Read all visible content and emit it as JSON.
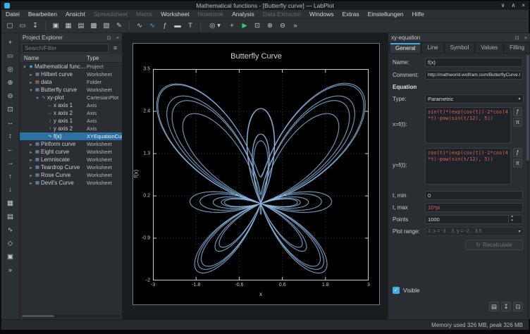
{
  "window": {
    "title": "Mathematical functions - [Butterfly curve] — LabPlot",
    "controls": [
      "∨",
      "∧",
      "×"
    ]
  },
  "icons": {
    "float": "⊡",
    "close": "×",
    "filter": "≡",
    "combo_arrow": "▾",
    "spin_up": "▴",
    "spin_down": "▾",
    "check": "✓"
  },
  "menu": {
    "items": [
      {
        "label": "Datei",
        "enabled": true
      },
      {
        "label": "Bearbeiten",
        "enabled": true
      },
      {
        "label": "Ansicht",
        "enabled": true
      },
      {
        "label": "Spreadsheet",
        "enabled": false
      },
      {
        "label": "Matrix",
        "enabled": false
      },
      {
        "label": "Worksheet",
        "enabled": true
      },
      {
        "label": "Notebook",
        "enabled": false
      },
      {
        "label": "Analysis",
        "enabled": true
      },
      {
        "label": "Data Extractor",
        "enabled": false
      },
      {
        "label": "Windows",
        "enabled": true
      },
      {
        "label": "Extras",
        "enabled": true
      },
      {
        "label": "Einstellungen",
        "enabled": true
      },
      {
        "label": "Hilfe",
        "enabled": true
      }
    ]
  },
  "toolbar": {
    "buttons": [
      {
        "name": "new-project",
        "glyph": "▢"
      },
      {
        "name": "open-project",
        "glyph": "▭"
      },
      {
        "name": "save-project",
        "glyph": "↧"
      },
      {
        "separator": true
      },
      {
        "name": "new-folder",
        "glyph": "▣"
      },
      {
        "name": "new-workbook",
        "glyph": "▦"
      },
      {
        "name": "new-spreadsheet",
        "glyph": "▤"
      },
      {
        "name": "new-matrix",
        "glyph": "▩"
      },
      {
        "name": "new-worksheet",
        "glyph": "▧"
      },
      {
        "name": "new-notebook",
        "glyph": "✎"
      },
      {
        "separator": true
      },
      {
        "name": "add-plot",
        "glyph": "∿"
      },
      {
        "name": "add-curve",
        "glyph": "∿",
        "color": "#3daee9"
      },
      {
        "name": "add-equation-curve",
        "glyph": "ƒ"
      },
      {
        "name": "add-legend",
        "glyph": "▬"
      },
      {
        "name": "add-text-label",
        "glyph": "T"
      },
      {
        "separator": true
      },
      {
        "name": "zoom-mode",
        "glyph": "◎",
        "combo": true
      },
      {
        "name": "select-mode",
        "glyph": "+"
      },
      {
        "name": "presenter-mode",
        "glyph": "▶",
        "color": "#2ecc71"
      },
      {
        "name": "fit-page",
        "glyph": "⊡"
      },
      {
        "name": "zoom-in",
        "glyph": "⊕"
      },
      {
        "name": "zoom-out",
        "glyph": "⊖"
      },
      {
        "name": "more-options",
        "glyph": "»"
      }
    ]
  },
  "left_toolbar": {
    "buttons": [
      {
        "name": "select-tool",
        "glyph": "+"
      },
      {
        "name": "zoom-select",
        "glyph": "▭"
      },
      {
        "name": "crosshair-tool",
        "glyph": "◎"
      },
      {
        "name": "zoom-in-plot",
        "glyph": "⊕"
      },
      {
        "name": "zoom-out-plot",
        "glyph": "⊖"
      },
      {
        "name": "auto-scale",
        "glyph": "⊡"
      },
      {
        "name": "auto-scale-x",
        "glyph": "↔"
      },
      {
        "name": "auto-scale-y",
        "glyph": "↕"
      },
      {
        "name": "shift-left",
        "glyph": "←"
      },
      {
        "name": "shift-right",
        "glyph": "→"
      },
      {
        "name": "shift-up",
        "glyph": "↑"
      },
      {
        "name": "shift-down",
        "glyph": "↓"
      },
      {
        "name": "grid-tool",
        "glyph": "▦"
      },
      {
        "name": "layout-tool",
        "glyph": "▤"
      },
      {
        "name": "add-curve-tool",
        "glyph": "∿"
      },
      {
        "name": "shape-tool",
        "glyph": "◇"
      },
      {
        "name": "add-element-tool",
        "glyph": "▣"
      },
      {
        "name": "more-tools",
        "glyph": "»"
      }
    ]
  },
  "project_explorer": {
    "title": "Project Explorer",
    "search_placeholder": "Search/Filter",
    "columns": {
      "name": "Name",
      "type": "Type"
    },
    "rows": [
      {
        "name": "Mathematical functions",
        "type": "Project",
        "depth": 0,
        "state": "expanded",
        "icon": "◆",
        "icon_name": "project-icon",
        "icon_color": "#3daee9",
        "selected": false
      },
      {
        "name": "Hilbert curve",
        "type": "Worksheet",
        "depth": 1,
        "state": "collapsed",
        "icon": "▦",
        "icon_name": "worksheet-icon",
        "icon_color": "#7ea6c9",
        "selected": false
      },
      {
        "name": "data",
        "type": "Folder",
        "depth": 1,
        "state": "collapsed",
        "icon": "▤",
        "icon_name": "folder-icon",
        "icon_color": "#d9a94a",
        "selected": false
      },
      {
        "name": "Butterfly curve",
        "type": "Worksheet",
        "depth": 1,
        "state": "expanded",
        "icon": "▦",
        "icon_name": "worksheet-icon",
        "icon_color": "#7ea6c9",
        "selected": false
      },
      {
        "name": "xy-plot",
        "type": "CartesianPlot",
        "depth": 2,
        "state": "expanded",
        "icon": "∿",
        "icon_name": "plot-icon",
        "icon_color": "#8fb3d5",
        "selected": false
      },
      {
        "name": "x axis 1",
        "type": "Axis",
        "depth": 3,
        "state": "leaf",
        "icon": "↔",
        "icon_name": "axis-icon",
        "icon_color": "#a5abb0",
        "selected": false
      },
      {
        "name": "x axis 2",
        "type": "Axis",
        "depth": 3,
        "state": "leaf",
        "icon": "↔",
        "icon_name": "axis-icon",
        "icon_color": "#a5abb0",
        "selected": false
      },
      {
        "name": "y axis 1",
        "type": "Axis",
        "depth": 3,
        "state": "leaf",
        "icon": "↕",
        "icon_name": "axis-icon",
        "icon_color": "#a5abb0",
        "selected": false
      },
      {
        "name": "y axis 2",
        "type": "Axis",
        "depth": 3,
        "state": "leaf",
        "icon": "↕",
        "icon_name": "axis-icon",
        "icon_color": "#a5abb0",
        "selected": false
      },
      {
        "name": "f(x)",
        "type": "XYEquationCurve",
        "depth": 3,
        "state": "leaf",
        "icon": "∿",
        "icon_name": "equation-curve-icon",
        "icon_color": "#ffffff",
        "selected": true
      },
      {
        "name": "Piriform curve",
        "type": "Worksheet",
        "depth": 1,
        "state": "collapsed",
        "icon": "▦",
        "icon_name": "worksheet-icon",
        "icon_color": "#7ea6c9",
        "selected": false
      },
      {
        "name": "Eight curve",
        "type": "Worksheet",
        "depth": 1,
        "state": "collapsed",
        "icon": "▦",
        "icon_name": "worksheet-icon",
        "icon_color": "#7ea6c9",
        "selected": false
      },
      {
        "name": "Lemniscate",
        "type": "Worksheet",
        "depth": 1,
        "state": "collapsed",
        "icon": "▦",
        "icon_name": "worksheet-icon",
        "icon_color": "#7ea6c9",
        "selected": false
      },
      {
        "name": "Teardrop Curve",
        "type": "Worksheet",
        "depth": 1,
        "state": "collapsed",
        "icon": "▦",
        "icon_name": "worksheet-icon",
        "icon_color": "#7ea6c9",
        "selected": false
      },
      {
        "name": "Rose Curve",
        "type": "Worksheet",
        "depth": 1,
        "state": "collapsed",
        "icon": "▦",
        "icon_name": "worksheet-icon",
        "icon_color": "#7ea6c9",
        "selected": false
      },
      {
        "name": "Devil's Curve",
        "type": "Worksheet",
        "depth": 1,
        "state": "collapsed",
        "icon": "▦",
        "icon_name": "worksheet-icon",
        "icon_color": "#7ea6c9",
        "selected": false
      }
    ]
  },
  "chart_data": {
    "type": "line",
    "title": "Butterfly Curve",
    "xlabel": "x",
    "ylabel": "f(x)",
    "xlim": [
      -3,
      3
    ],
    "ylim": [
      -2,
      3.5
    ],
    "xticks": [
      -3,
      -1.8,
      -0.6,
      0.6,
      1.8,
      3
    ],
    "yticks": [
      -2,
      -0.9,
      0.2,
      1.3,
      2.4,
      3.5
    ],
    "parametric": {
      "x_equation": "sin(t)*(exp(cos(t))-2*cos(4*t)-pow(sin(t/12), 5))",
      "y_equation": "cos(t)*(exp(cos(t))-2*cos(4*t)-pow(sin(t/12), 5))",
      "t_min": "0",
      "t_max": "10*pi",
      "points": 1000
    },
    "curve_color": "#8fb6de",
    "grid": true,
    "legend": false
  },
  "properties": {
    "dock_title": "xy-equation",
    "tabs": [
      "General",
      "Line",
      "Symbol",
      "Values",
      "Filling"
    ],
    "active_tab": "General",
    "name_label": "Name:",
    "name_value": "f(x)",
    "comment_label": "Comment:",
    "comment_value": "http://mathworld.wolfram.com/ButterflyCurve.html",
    "section_equation": "Equation",
    "type_label": "Type:",
    "type_value": "Parametric",
    "x_label": "x=f(t):",
    "x_equation": "sin(t)*(exp(cos(t))-2*cos(4*t)-pow(sin(t/12), 5))",
    "y_label": "y=f(t):",
    "y_equation": "cos(t)*(exp(cos(t))-2*cos(4*t)-pow(sin(t/12), 5))",
    "fn_button_glyph": "ƒ",
    "pi_button_glyph": "π",
    "tmin_label": "t, min",
    "tmin_value": "0",
    "tmax_label": "t, max",
    "tmax_value": "10*pi",
    "points_label": "Points",
    "points_value": "1000",
    "plot_range_label": "Plot range:",
    "plot_range_value": "1: x = -3 .. 3, y = -2 .. 3.5",
    "recalculate_label": "Recalculate",
    "recalculate_icon": "↻",
    "visible_label": "Visible",
    "visible_checked": true
  },
  "status_bar": {
    "memory": "Memory used 326 MB, peak 326 MB"
  }
}
